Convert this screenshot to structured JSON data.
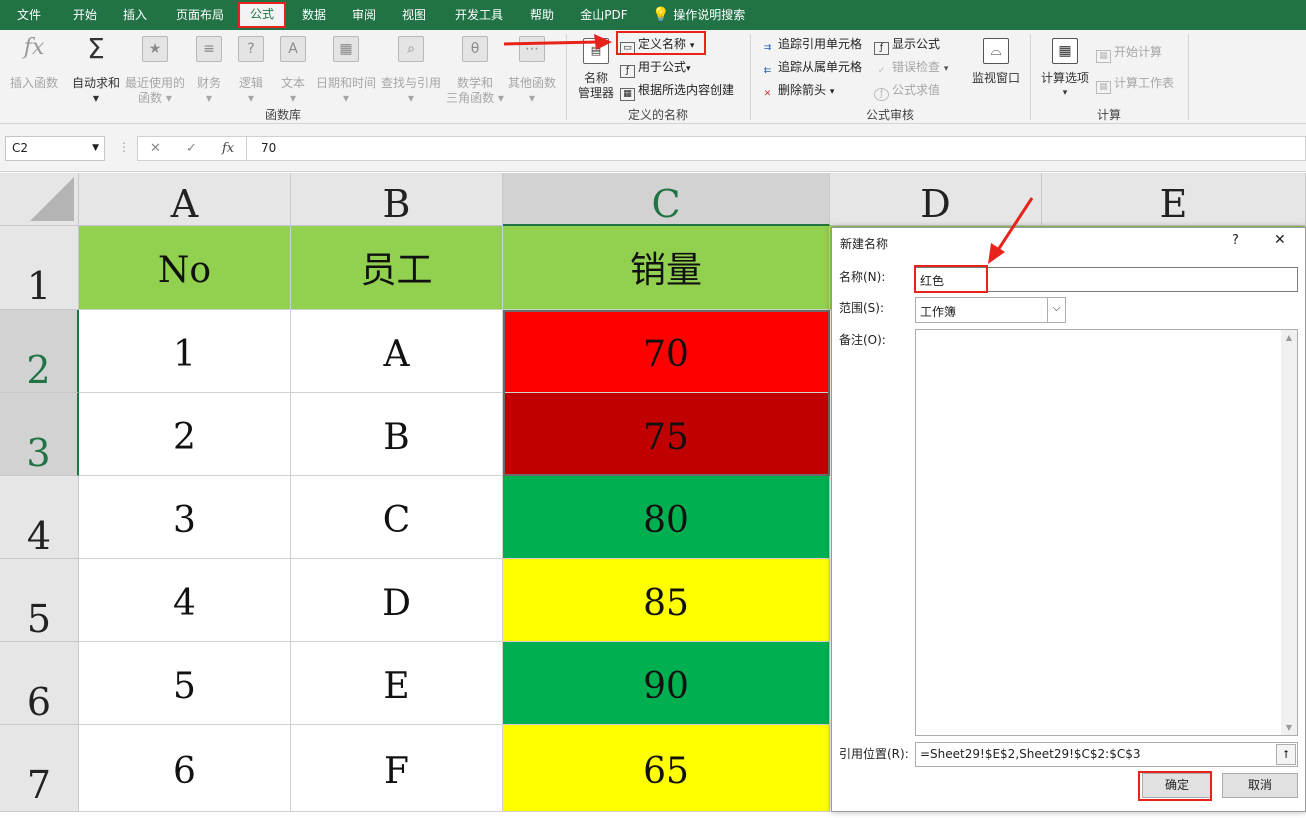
{
  "menu": {
    "tabs": [
      "文件",
      "开始",
      "插入",
      "页面布局",
      "公式",
      "数据",
      "审阅",
      "视图",
      "开发工具",
      "帮助",
      "金山PDF"
    ],
    "active": "公式",
    "tell_me": "操作说明搜索"
  },
  "ribbon": {
    "lib": {
      "insert_fn": "插入函数",
      "autosum": "自动求和",
      "recent_1": "最近使用的",
      "recent_2": "函数",
      "financial": "财务",
      "logical": "逻辑",
      "text": "文本",
      "datetime": "日期和时间",
      "lookup": "查找与引用",
      "math_1": "数学和",
      "math_2": "三角函数",
      "more": "其他函数",
      "group": "函数库"
    },
    "names": {
      "manager_1": "名称",
      "manager_2": "管理器",
      "define": "定义名称",
      "use": "用于公式",
      "create": "根据所选内容创建",
      "group": "定义的名称"
    },
    "audit": {
      "trace_prec": "追踪引用单元格",
      "trace_dep": "追踪从属单元格",
      "remove": "删除箭头",
      "show": "显示公式",
      "check": "错误检查",
      "eval": "公式求值",
      "watch": "监视窗口",
      "group": "公式审核"
    },
    "calc": {
      "options": "计算选项",
      "now": "开始计算",
      "sheet": "计算工作表",
      "group": "计算"
    }
  },
  "formula_bar": {
    "name_box": "C2",
    "fx": "fx",
    "value": "70"
  },
  "grid": {
    "columns": [
      "A",
      "B",
      "C",
      "D",
      "E"
    ],
    "rows": [
      "1",
      "2",
      "3",
      "4",
      "5",
      "6",
      "7"
    ],
    "header": [
      "No",
      "员工",
      "销量"
    ],
    "data": [
      [
        "1",
        "A",
        "70"
      ],
      [
        "2",
        "B",
        "75"
      ],
      [
        "3",
        "C",
        "80"
      ],
      [
        "4",
        "D",
        "85"
      ],
      [
        "5",
        "E",
        "90"
      ],
      [
        "6",
        "F",
        "65"
      ]
    ],
    "colors": {
      "header": "#92d050",
      "c": [
        "#ff0000",
        "#c00000",
        "#00b050",
        "#ffff00",
        "#00b050",
        "#ffff00"
      ]
    }
  },
  "dialog": {
    "title": "新建名称",
    "help": "?",
    "close": "✕",
    "name_label": "名称(N):",
    "name_value": "红色",
    "scope_label": "范围(S):",
    "scope_value": "工作簿",
    "comment_label": "备注(O):",
    "ref_label": "引用位置(R):",
    "ref_value": "=Sheet29!$E$2,Sheet29!$C$2:$C$3",
    "ok": "确定",
    "cancel": "取消"
  }
}
